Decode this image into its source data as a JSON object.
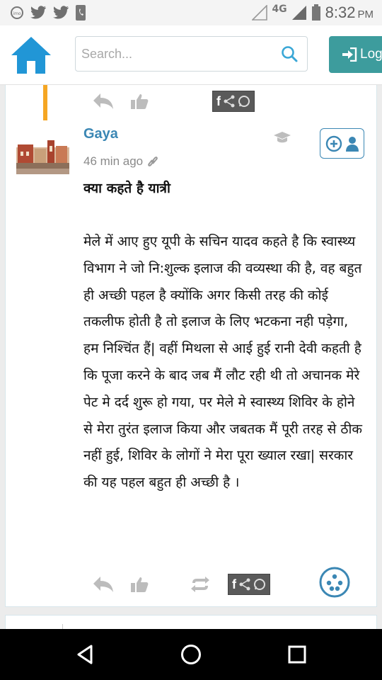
{
  "status_bar": {
    "network": "4G",
    "time": "8:32",
    "ampm": "PM",
    "icons": [
      "imo-icon",
      "twitter-icon",
      "twitter-icon",
      "phone-icon",
      "signal-icon",
      "signal-icon",
      "battery-icon"
    ]
  },
  "header": {
    "search_placeholder": "Search...",
    "login_label": "Log",
    "colors": {
      "accent": "#3d9c9d",
      "home": "#2196d6",
      "link": "#3b87b4"
    }
  },
  "post": {
    "author": "Gaya",
    "time_ago": "46 min ago",
    "title": "क्या कहते है यात्री",
    "body": "मेले में आए हुए यूपी के सचिन यादव कहते है कि स्वास्थ्य विभाग ने जो नि:शुल्क इलाज की वव्यस्था की है, वह बहुत ही अच्छी पहल है क्योंकि अगर किसी तरह की कोई तकलीफ होती है तो इलाज के लिए भटकना नही पड़ेगा, हम निश्चिंत हैं| वहीं मिथला से आई हुई रानी देवी कहती है कि पूजा करने के बाद जब मैं लौट रही थी तो अचानक मेरे पेट मे दर्द शुरू हो गया, पर मेले मे स्वास्थ्य शिविर के होने से मेरा तुरंत इलाज किया और जबतक मैं पूरी तरह से ठीक नहीं हुई, शिविर के लोगों ने मेरा पूरा ख्याल रखा| सरकार की यह पहल बहुत ही अच्छी है ।",
    "share_glyph": "f"
  }
}
